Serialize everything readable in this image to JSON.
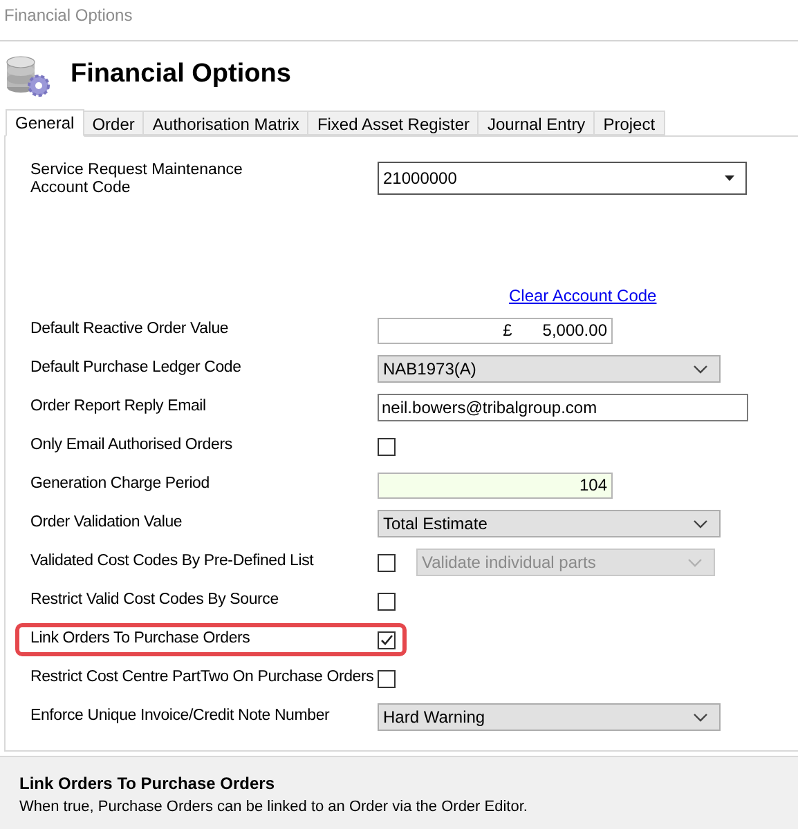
{
  "window": {
    "title": "Financial Options"
  },
  "header": {
    "title": "Financial Options"
  },
  "tabs": [
    {
      "label": "General",
      "selected": true
    },
    {
      "label": "Order",
      "selected": false
    },
    {
      "label": "Authorisation Matrix",
      "selected": false
    },
    {
      "label": "Fixed Asset Register",
      "selected": false
    },
    {
      "label": "Journal Entry",
      "selected": false
    },
    {
      "label": "Project",
      "selected": false
    }
  ],
  "account_code": {
    "label": "Service Request Maintenance Account Code",
    "value": "21000000",
    "link": "Clear Account Code"
  },
  "rows": [
    {
      "kind": "currency",
      "label": "Default Reactive Order Value",
      "currency": "£",
      "value": "5,000.00",
      "highlighted": false
    },
    {
      "kind": "dropdown",
      "label": "Default Purchase Ledger Code",
      "value": "NAB1973(A)",
      "highlighted": false
    },
    {
      "kind": "text",
      "label": "Order Report Reply Email",
      "value": "neil.bowers@tribalgroup.com",
      "highlighted": false
    },
    {
      "kind": "checkbox",
      "label": "Only Email Authorised Orders",
      "checked": false,
      "highlighted": false
    },
    {
      "kind": "number",
      "label": "Generation Charge Period",
      "value": "104",
      "highlighted": false
    },
    {
      "kind": "dropdown",
      "label": "Order Validation Value",
      "value": "Total Estimate",
      "highlighted": false
    },
    {
      "kind": "checkbox-dropdown",
      "label": "Validated Cost Codes By Pre-Defined List",
      "checked": false,
      "value": "Validate individual parts",
      "disabled": true,
      "highlighted": false
    },
    {
      "kind": "checkbox",
      "label": "Restrict Valid Cost Codes By Source",
      "checked": false,
      "highlighted": false
    },
    {
      "kind": "checkbox",
      "label": "Link Orders To Purchase Orders",
      "checked": true,
      "highlighted": true
    },
    {
      "kind": "checkbox",
      "label": "Restrict Cost Centre PartTwo On Purchase Orders",
      "checked": false,
      "highlighted": false
    },
    {
      "kind": "dropdown",
      "label": "Enforce Unique Invoice/Credit Note Number",
      "value": "Hard Warning",
      "highlighted": false
    }
  ],
  "description": {
    "title": "Link Orders To Purchase Orders",
    "text": "When true, Purchase Orders can be linked to an Order via the Order Editor."
  }
}
